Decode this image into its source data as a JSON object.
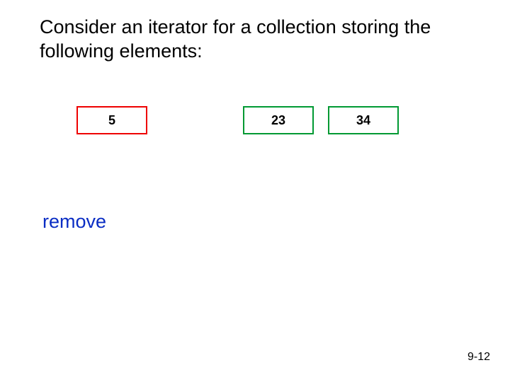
{
  "heading": "Consider an iterator for a collection storing the following elements:",
  "elements": {
    "first": "5",
    "second": "23",
    "third": "34"
  },
  "action_label": "remove",
  "page_number": "9-12"
}
